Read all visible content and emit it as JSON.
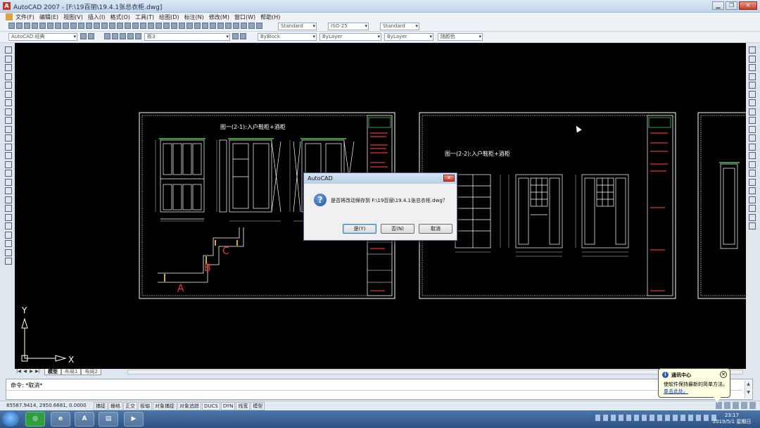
{
  "window": {
    "title": "AutoCAD 2007 - [F:\\19百丽\\19.4.1张总衣柜.dwg]",
    "app_icon": "A",
    "minimize": "▁",
    "restore": "❐",
    "close": "✕"
  },
  "menu": {
    "items": [
      "文件(F)",
      "编辑(E)",
      "视图(V)",
      "插入(I)",
      "格式(O)",
      "工具(T)",
      "绘图(D)",
      "标注(N)",
      "修改(M)",
      "窗口(W)",
      "帮助(H)"
    ]
  },
  "toolbar": {
    "text_style": "Standard",
    "dim_style": "ISO-25",
    "table_style": "Standard",
    "workspace": "AutoCAD 经典",
    "layer": "板3",
    "color": "ByBlock",
    "linetype": "ByLayer",
    "lineweight": "ByLayer",
    "plot_style": "随颜色"
  },
  "drawing": {
    "sheet1_title": "图一(2-1):入户鞋柜+酒柜",
    "sheet2_title": "图一(2-2):入户鞋柜+酒柜",
    "label_a": "A",
    "label_b": "B",
    "label_c": "C",
    "axis_y": "Y",
    "axis_x": "X"
  },
  "tabs": {
    "nav": [
      "|◀",
      "◀",
      "▶",
      "▶|"
    ],
    "items": [
      "模型",
      "布局1",
      "布局2"
    ]
  },
  "command": {
    "history": "命令: *取消*",
    "prompt": ""
  },
  "status": {
    "coords": "85587.9414, 2950.6681, 0.0000",
    "modes": [
      "捕捉",
      "栅格",
      "正交",
      "极轴",
      "对象捕捉",
      "对象追踪",
      "DUCS",
      "DYN",
      "线宽",
      "模型"
    ]
  },
  "balloon": {
    "title": "通讯中心",
    "message": "使软件保持最新的简单方法。",
    "link": "单击此处。"
  },
  "dialog": {
    "title": "AutoCAD",
    "message": "是否将改动保存到 F:\\19百丽\\19.4.1张总衣柜.dwg？",
    "btn_yes": "是(Y)",
    "btn_no": "否(N)",
    "btn_cancel": "取消"
  },
  "taskbar": {
    "time": "23:17",
    "date": "2019/5/1 星期日"
  }
}
